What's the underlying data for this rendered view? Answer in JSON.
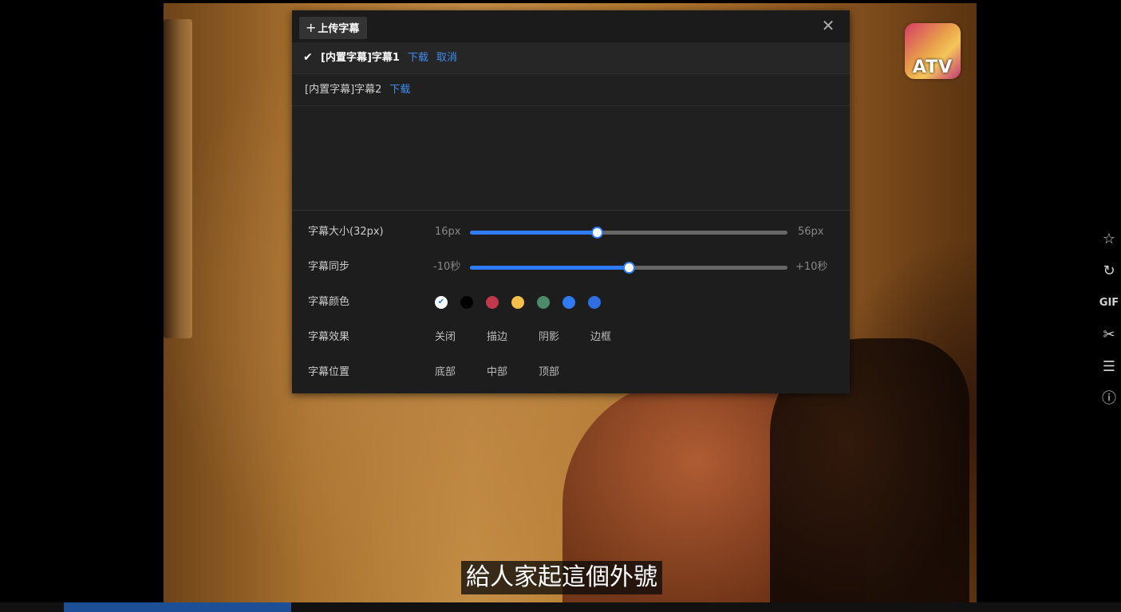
{
  "video": {
    "logo_text": "ATV",
    "subtitle": "給人家起這個外號"
  },
  "panel": {
    "upload_label": "上传字幕",
    "close_icon": "close-icon",
    "tracks": [
      {
        "name": "[内置字幕]字幕1",
        "download": "下载",
        "cancel": "取消",
        "active": true
      },
      {
        "name": "[内置字幕]字幕2",
        "download": "下载",
        "active": false
      }
    ],
    "settings": {
      "size": {
        "label": "字幕大小(32px)",
        "min": "16px",
        "max": "56px",
        "value": 32,
        "range": [
          16,
          56
        ]
      },
      "sync": {
        "label": "字幕同步",
        "min": "-10秒",
        "max": "+10秒",
        "value": 0,
        "range": [
          -10,
          10
        ]
      },
      "color": {
        "label": "字幕颜色",
        "swatches": [
          "#ffffff",
          "#000000",
          "#c0394b",
          "#f5c04a",
          "#4d8a6a",
          "#2f7bf5",
          "#2f6ee0"
        ],
        "selected_index": 0
      },
      "effect": {
        "label": "字幕效果",
        "options": [
          "关闭",
          "描边",
          "阴影",
          "边框"
        ],
        "selected_index": 3
      },
      "position": {
        "label": "字幕位置",
        "options": [
          "底部",
          "中部",
          "顶部"
        ],
        "selected_index": 0
      }
    }
  },
  "side_toolbar": {
    "gif_label": "GIF",
    "icons": [
      "star-icon",
      "share-icon",
      "gif-icon",
      "scissors-icon",
      "list-icon",
      "help-icon"
    ]
  },
  "colors": {
    "accent": "#2f7bf5",
    "panel_bg": "#1d1d1d"
  }
}
